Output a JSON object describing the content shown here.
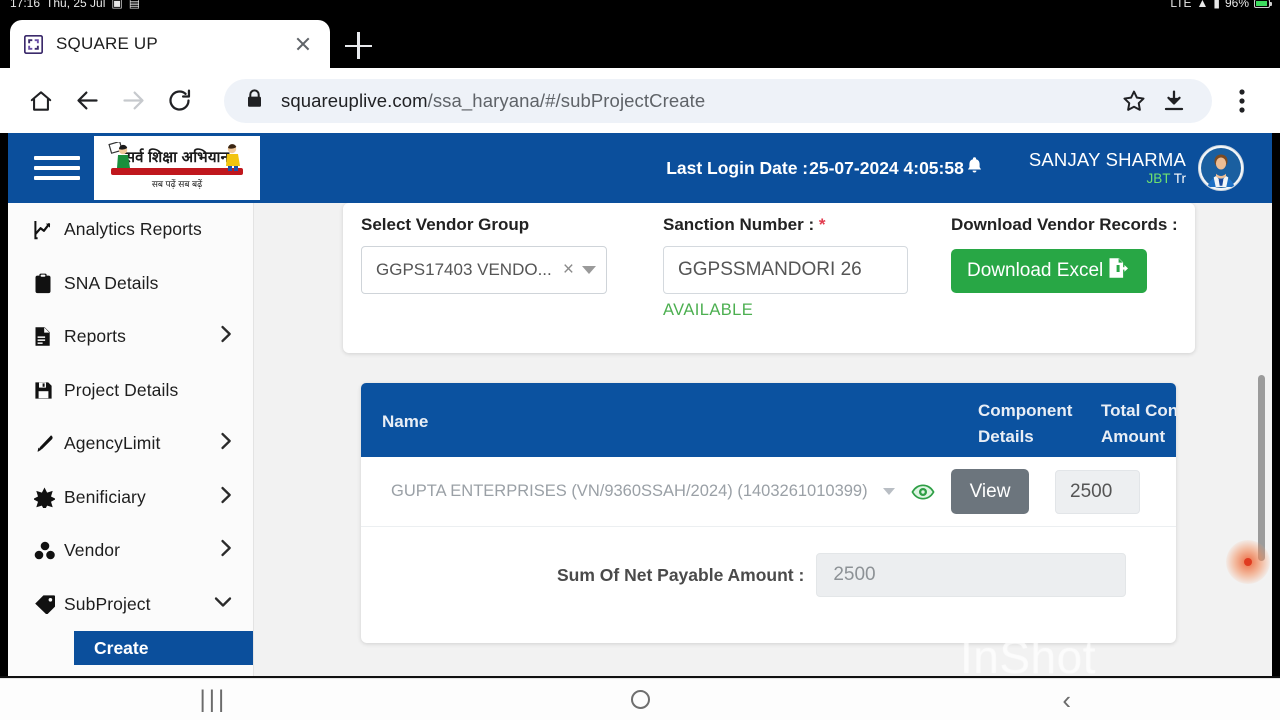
{
  "status_bar": {
    "time": "17:16",
    "date": "Thu, 25 Jul",
    "battery": "96%",
    "network": "LTE",
    "left_icons": [
      "screenshot-icon",
      "image-icon"
    ],
    "right_icons": [
      "lte-icon",
      "wifi-icon",
      "signal-icon",
      "battery-icon"
    ]
  },
  "browser": {
    "tab": {
      "title": "SQUARE UP",
      "favicon_name": "square-up-favicon",
      "close_label": "Close tab"
    },
    "new_tab_label": "New tab",
    "toolbar": {
      "home_label": "Home",
      "back_label": "Back",
      "forward_label": "Forward",
      "reload_label": "Reload",
      "bookmark_label": "Bookmark",
      "download_label": "Downloads",
      "menu_label": "More options"
    },
    "omnibox": {
      "secure": true,
      "domain": "squareuplive.com",
      "path": "/ssa_haryana/#/subProjectCreate",
      "full_url": "squareuplive.com/ssa_haryana/#/subProjectCreate"
    }
  },
  "app_header": {
    "menu_label": "Menu",
    "logo": {
      "title_hi": "सर्व शिक्षा अभियान",
      "tagline_hi": "सब पढ़ें  सब बढ़ें"
    },
    "last_login_label": "Last Login Date :",
    "last_login_value": "25-07-2024 4:05:58",
    "notification_icon": "bell-icon",
    "user_name": "SANJAY SHARMA",
    "user_role_primary": "JBT",
    "user_role_secondary": "Tr",
    "avatar_label": "User avatar"
  },
  "sidebar": {
    "items": [
      {
        "label": "Analytics Reports",
        "icon": "chart-line-icon",
        "expandable": false,
        "expanded": false
      },
      {
        "label": "SNA Details",
        "icon": "clipboard-icon",
        "expandable": false,
        "expanded": false
      },
      {
        "label": "Reports",
        "icon": "file-text-icon",
        "expandable": true,
        "expanded": false
      },
      {
        "label": "Project Details",
        "icon": "save-disk-icon",
        "expandable": false,
        "expanded": false
      },
      {
        "label": "AgencyLimit",
        "icon": "pen-icon",
        "expandable": true,
        "expanded": false
      },
      {
        "label": "Benificiary",
        "icon": "star-burst-icon",
        "expandable": true,
        "expanded": false
      },
      {
        "label": "Vendor",
        "icon": "cubes-icon",
        "expandable": true,
        "expanded": false
      },
      {
        "label": "SubProject",
        "icon": "tag-icon",
        "expandable": true,
        "expanded": true
      }
    ],
    "submenu": {
      "label": "Create",
      "active": true
    }
  },
  "form": {
    "vendor_group": {
      "label": "Select Vendor Group",
      "value": "GGPS17403 VENDO...",
      "clear_label": "×",
      "caret_label": "Open dropdown"
    },
    "sanction_number": {
      "label": "Sanction Number :",
      "required_marker": "*",
      "value": "GGPSSMANDORI 26",
      "status": "AVAILABLE"
    },
    "download": {
      "label": "Download Vendor Records :",
      "button_label": "Download Excel",
      "button_icon": "file-export-icon",
      "button_color": "#28a745"
    }
  },
  "table": {
    "headers": {
      "name": "Name",
      "component_details": "Component Details",
      "total_contract_amount": "Total Con Amount"
    },
    "rows": [
      {
        "vendor": "GUPTA ENTERPRISES (VN/9360SSAH/2024) (1403261010399)",
        "eye_icon": "eye-icon",
        "view_button": "View",
        "amount": "2500"
      }
    ],
    "summary": {
      "label": "Sum Of Net Payable Amount :",
      "value": "2500"
    }
  },
  "watermark": "InShot",
  "nav_bar": {
    "recents_label": "Recents",
    "home_label": "Home",
    "back_label": "Back"
  },
  "colors": {
    "brand_blue": "#0b4f9c",
    "table_header_blue": "#0b52a0",
    "success_green": "#28a745",
    "available_green": "#4caf50",
    "required_red": "#e23b4e",
    "view_gray": "#6c757d"
  }
}
